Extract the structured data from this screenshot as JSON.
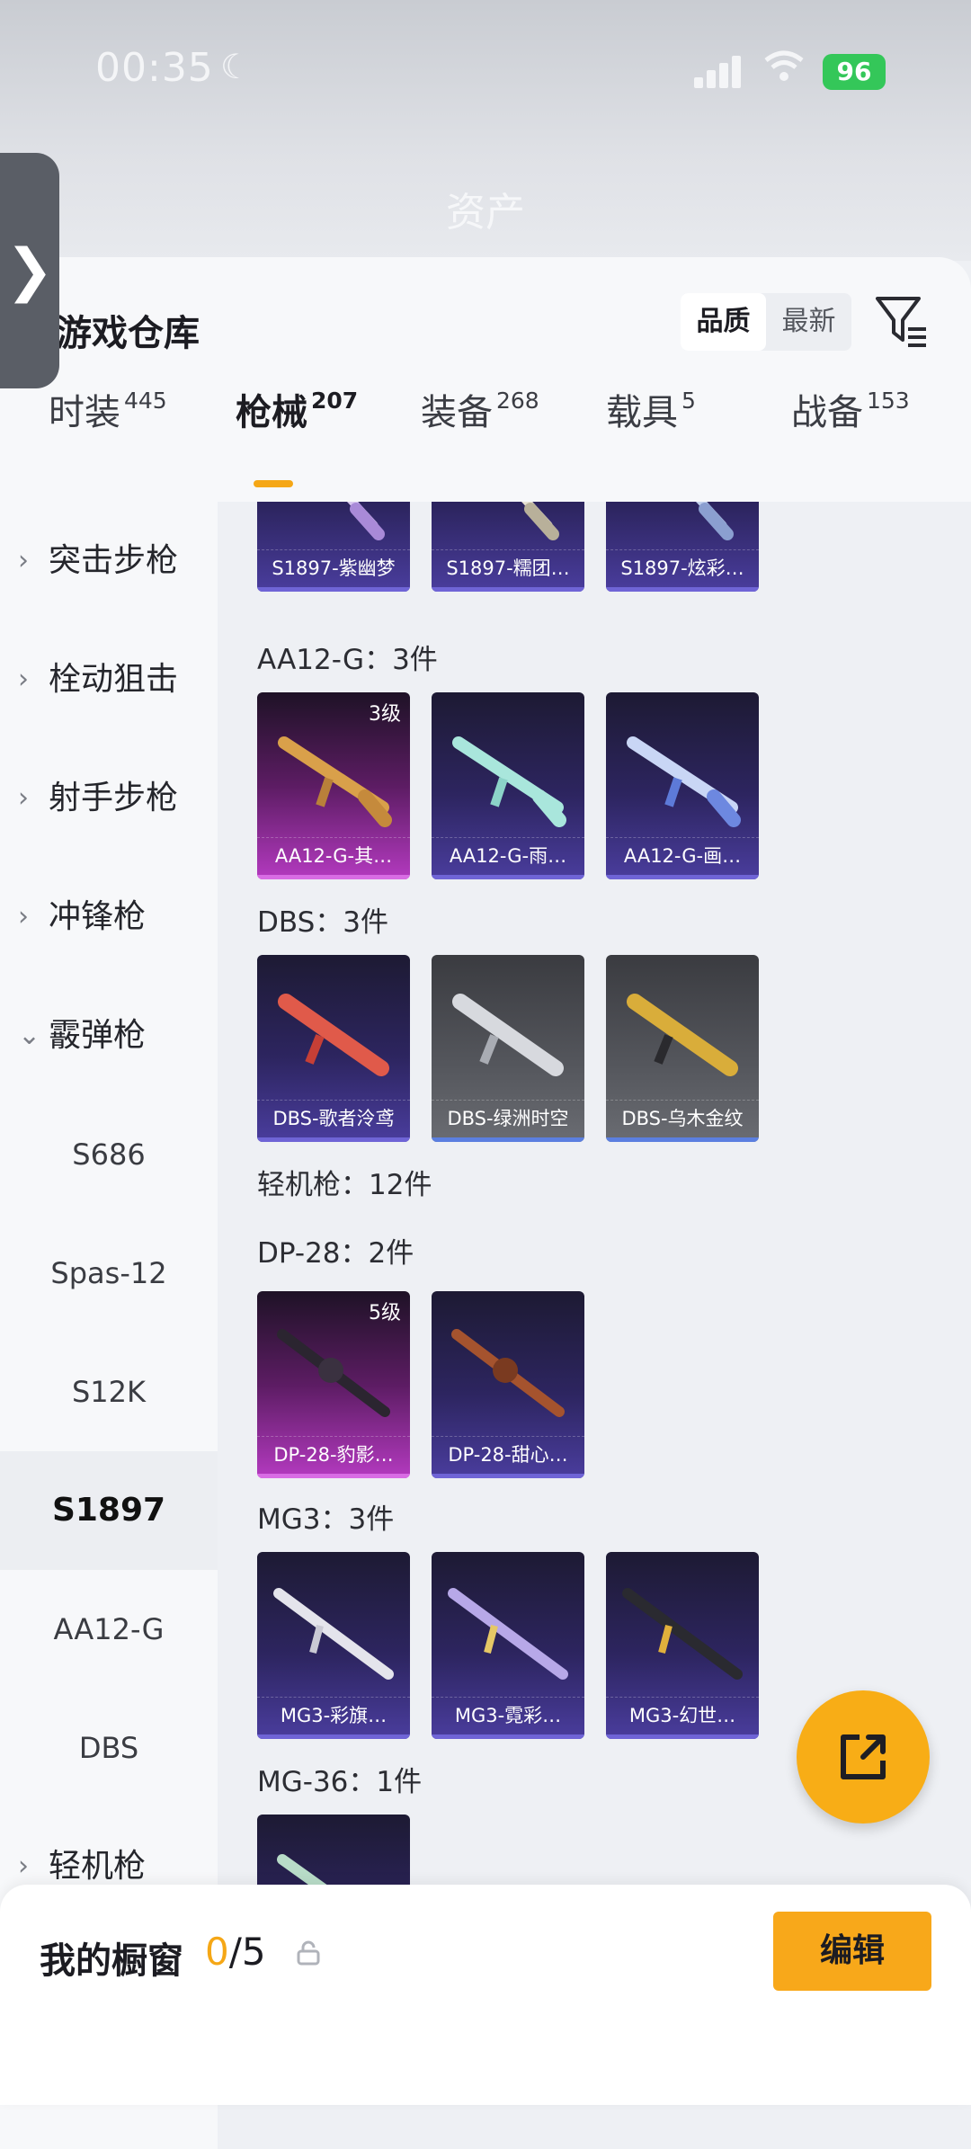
{
  "status_bar": {
    "time": "00:35",
    "battery": "96"
  },
  "page": {
    "title": "资产"
  },
  "header": {
    "title": "游戏仓库",
    "sort_options": [
      "品质",
      "最新"
    ],
    "active_sort": "品质"
  },
  "tabs": [
    {
      "label": "时装",
      "count": "445"
    },
    {
      "label": "枪械",
      "count": "207"
    },
    {
      "label": "装备",
      "count": "268"
    },
    {
      "label": "载具",
      "count": "5"
    },
    {
      "label": "战备",
      "count": "153"
    }
  ],
  "active_tab": "枪械",
  "sidebar": {
    "categories": [
      "突击步枪",
      "栓动狙击",
      "射手步枪",
      "冲锋枪",
      "霰弹枪"
    ],
    "subitems": [
      "S686",
      "Spas-12",
      "S12K",
      "S1897",
      "AA12-G",
      "DBS"
    ],
    "active_subitem": "S1897",
    "bottom_category": "轻机枪"
  },
  "content": {
    "s1897_partial": [
      "S1897-紫幽梦",
      "S1897-糯团…",
      "S1897-炫彩…"
    ],
    "aa12_title": "AA12-G：3件",
    "aa12": [
      {
        "name": "AA12-G-其…",
        "level": "3级"
      },
      {
        "name": "AA12-G-雨…"
      },
      {
        "name": "AA12-G-画…"
      }
    ],
    "dbs_title": "DBS：3件",
    "dbs": [
      {
        "name": "DBS-歌者泠鸢"
      },
      {
        "name": "DBS-绿洲时空"
      },
      {
        "name": "DBS-乌木金纹"
      }
    ],
    "lmg_title": "轻机枪：12件",
    "dp28_title": "DP-28：2件",
    "dp28": [
      {
        "name": "DP-28-豹影…",
        "level": "5级"
      },
      {
        "name": "DP-28-甜心…"
      }
    ],
    "mg3_title": "MG3：3件",
    "mg3": [
      {
        "name": "MG3-彩旗…"
      },
      {
        "name": "MG3-霓彩…"
      },
      {
        "name": "MG3-幻世…"
      }
    ],
    "mg36_title": "MG-36：1件"
  },
  "bottom_bar": {
    "label": "我的橱窗",
    "current": "0",
    "separator": "/",
    "max": "5",
    "edit_label": "编辑"
  },
  "colors": {
    "accent": "#f5a716",
    "fab": "#f8ad16",
    "battery": "#34c759"
  }
}
